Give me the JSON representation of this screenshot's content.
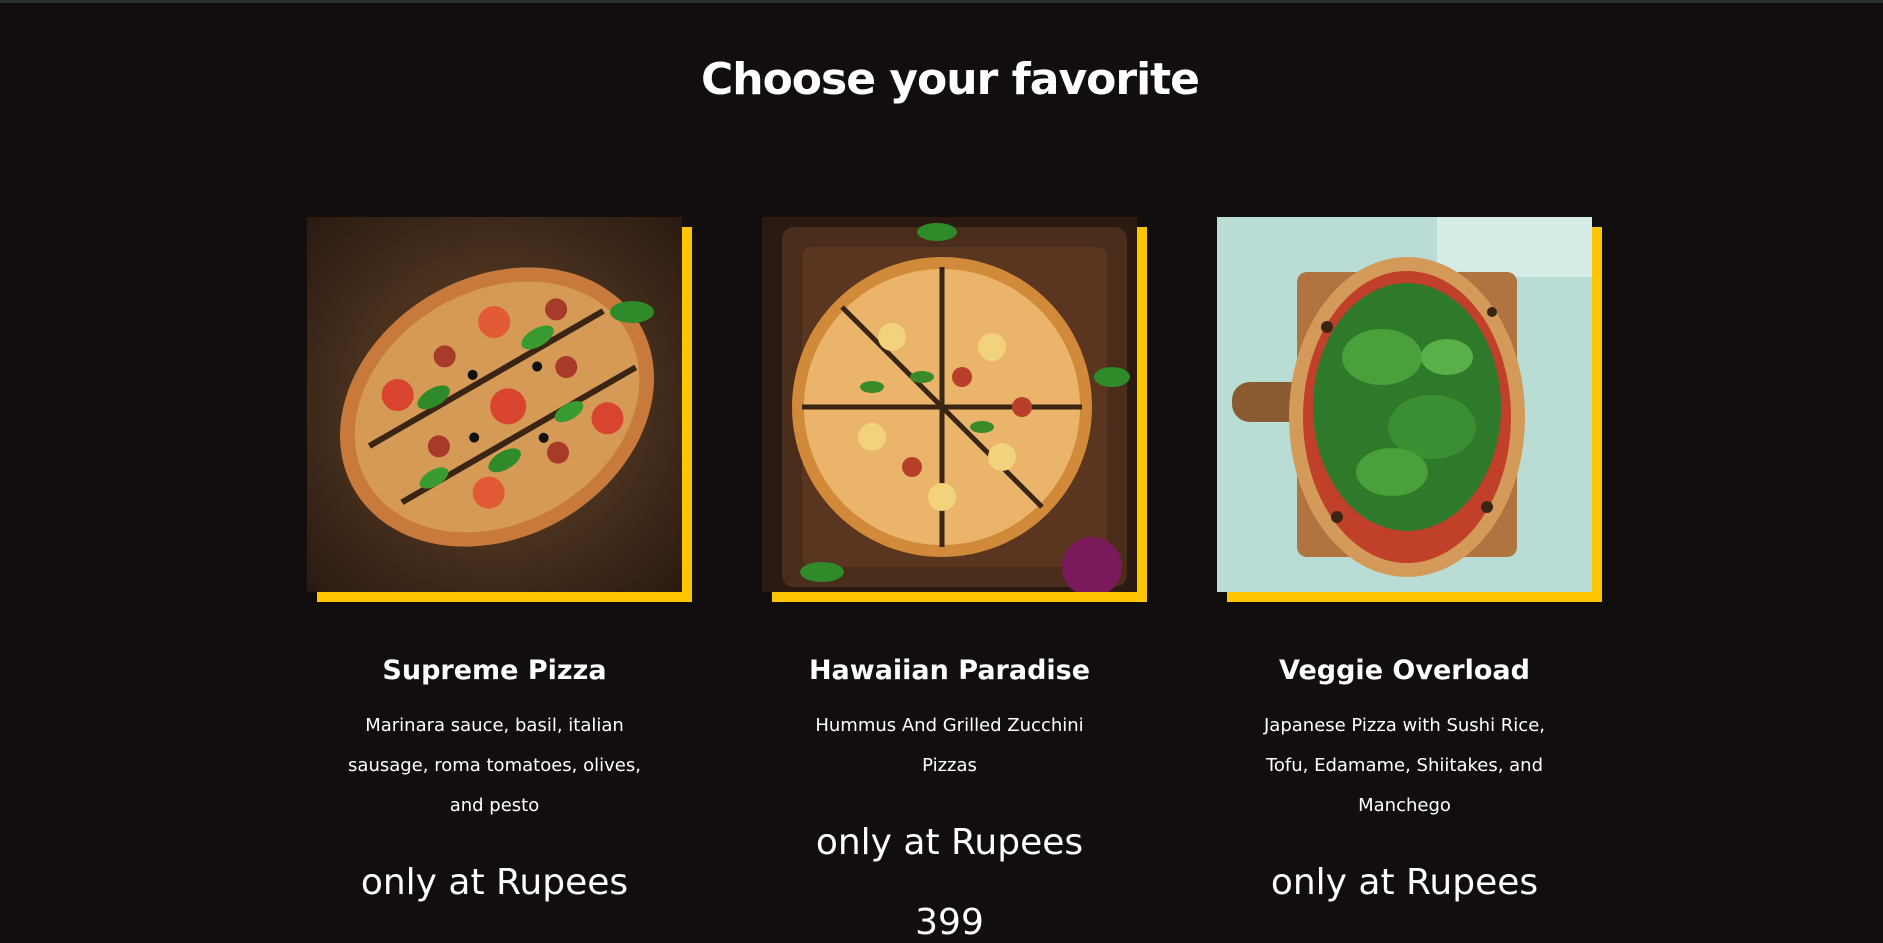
{
  "section": {
    "title": "Choose your favorite"
  },
  "colors": {
    "background": "#130e0e",
    "accent": "#ffc500",
    "text": "#ffffff"
  },
  "cards": [
    {
      "title": "Supreme Pizza",
      "description": "Marinara sauce, basil, italian sausage, roma tomatoes, olives, and pesto",
      "price_label": "only at Rupees",
      "price": "",
      "image": "supreme-pizza-photo"
    },
    {
      "title": "Hawaiian Paradise",
      "description": "Hummus And Grilled Zucchini Pizzas",
      "price_label": "only at Rupees",
      "price": "399",
      "image": "hawaiian-pizza-photo"
    },
    {
      "title": "Veggie Overload",
      "description": "Japanese Pizza with Sushi Rice, Tofu, Edamame, Shiitakes, and Manchego",
      "price_label": "only at Rupees",
      "price": "",
      "image": "veggie-pizza-photo"
    }
  ]
}
